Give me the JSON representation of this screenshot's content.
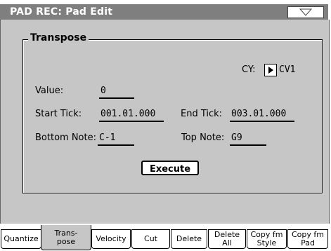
{
  "title": "PAD REC: Pad Edit",
  "menu_icon": "triangle-down-icon",
  "group": {
    "title": "Transpose",
    "cy_label": "CY:",
    "cy_value": "CV1",
    "cy_icon": "play-triangle-icon",
    "value_label": "Value:",
    "value": "0",
    "start_tick_label": "Start Tick:",
    "start_tick": "001.01.000",
    "end_tick_label": "End Tick:",
    "end_tick": "003.01.000",
    "bottom_note_label": "Bottom Note:",
    "bottom_note": "C-1",
    "top_note_label": "Top Note:",
    "top_note": "G9",
    "execute_label": "Execute"
  },
  "tabs": [
    {
      "label": "Quantize"
    },
    {
      "label": "Trans-\npose",
      "active": true
    },
    {
      "label": "Velocity"
    },
    {
      "label": "Cut"
    },
    {
      "label": "Delete"
    },
    {
      "label": "Delete\nAll"
    },
    {
      "label": "Copy fm\nStyle"
    },
    {
      "label": "Copy fm\nPad"
    }
  ]
}
